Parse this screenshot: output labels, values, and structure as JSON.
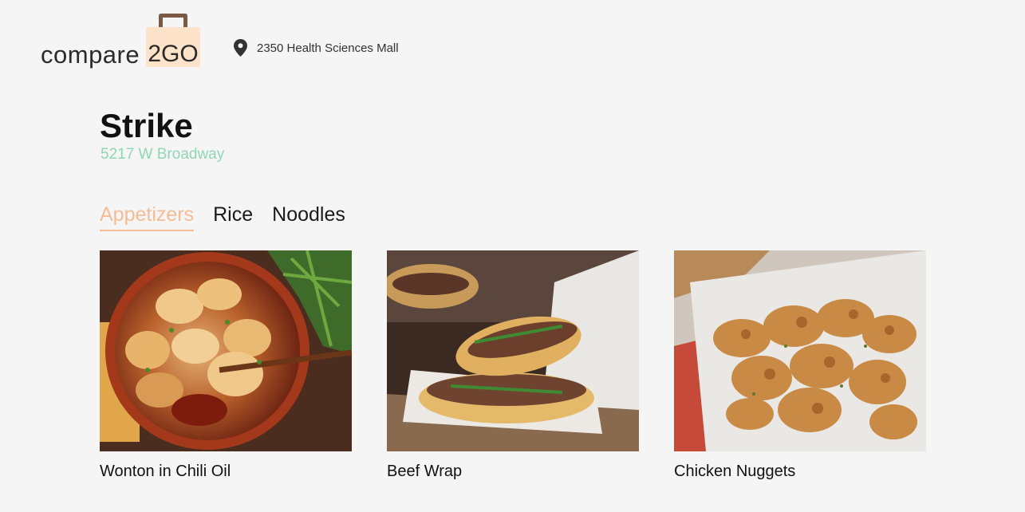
{
  "header": {
    "logo_word": "compare",
    "logo_badge": "2GO",
    "location": "2350 Health Sciences Mall",
    "location_icon": "map-pin-icon"
  },
  "restaurant": {
    "name": "Strike",
    "address": "5217 W Broadway"
  },
  "tabs": [
    {
      "label": "Appetizers",
      "active": true
    },
    {
      "label": "Rice",
      "active": false
    },
    {
      "label": "Noodles",
      "active": false
    }
  ],
  "items": [
    {
      "title": "Wonton in Chili Oil"
    },
    {
      "title": "Beef Wrap"
    },
    {
      "title": "Chicken Nuggets"
    }
  ],
  "colors": {
    "accent": "#f4bd95",
    "address": "#8fd6b4",
    "logo_bag": "#fde3c9",
    "background": "#f5f5f5"
  }
}
